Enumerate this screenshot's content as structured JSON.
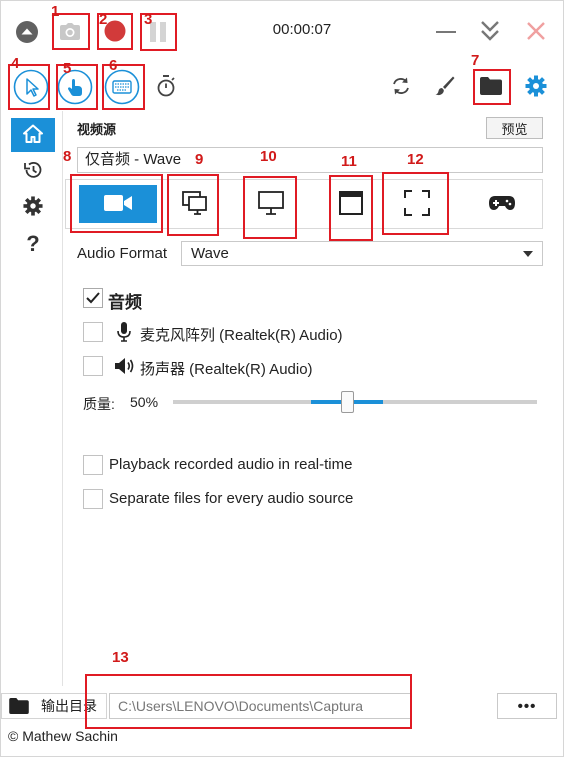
{
  "topbar": {
    "timer": "00:00:07",
    "icons": [
      "collapse-up-icon",
      "camera-icon",
      "record-icon",
      "pause-icon",
      "minimize-icon",
      "double-chevron-down-icon",
      "close-icon"
    ]
  },
  "toolbar": {
    "icons": [
      "cursor-icon",
      "hand-click-icon",
      "keyboard-icon",
      "stopwatch-icon",
      "refresh-icon",
      "brush-icon",
      "folder-icon",
      "settings-icon"
    ]
  },
  "sidebar": {
    "items": [
      "home-icon",
      "history-icon",
      "settings-icon",
      "help-icon"
    ],
    "help_label": "?"
  },
  "video_source": {
    "title": "视频源",
    "preview_label": "预览",
    "current_source": "仅音频 - Wave",
    "source_buttons": [
      "video-camera-icon",
      "screen-overlay-icon",
      "monitor-icon",
      "window-icon",
      "region-icon",
      "gamepad-icon"
    ]
  },
  "audio_format": {
    "label": "Audio Format",
    "value": "Wave"
  },
  "audio": {
    "section_label": "音频",
    "section_checked": true,
    "devices": [
      {
        "label": "麦克风阵列 (Realtek(R) Audio)",
        "checked": false,
        "icon": "microphone-icon"
      },
      {
        "label": "扬声器 (Realtek(R) Audio)",
        "checked": false,
        "icon": "speaker-icon"
      }
    ],
    "quality_label": "质量:",
    "quality_value": "50%",
    "quality_fraction": 0.5
  },
  "options": {
    "playback": "Playback recorded audio in real-time",
    "separate": "Separate files for every audio source"
  },
  "output": {
    "label": "输出目录",
    "path": "C:\\Users\\LENOVO\\Documents\\Captura",
    "more_label": "•••"
  },
  "footer": {
    "copyright": "© Mathew Sachin"
  },
  "annotations": [
    "1",
    "2",
    "3",
    "4",
    "5",
    "6",
    "7",
    "8",
    "9",
    "10",
    "11",
    "12",
    "13"
  ],
  "colors": {
    "accent": "#1b90d8",
    "record": "#d23a3a",
    "annotation": "#e01b24"
  }
}
